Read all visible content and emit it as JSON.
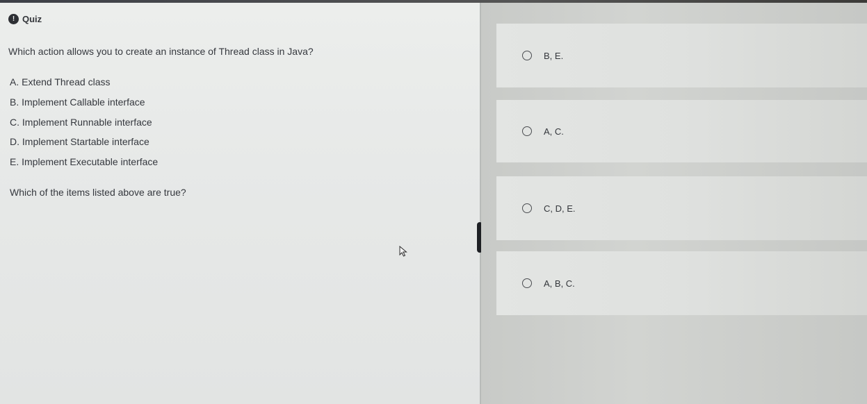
{
  "header": {
    "icon": "info-circle-icon",
    "icon_glyph": "!",
    "title": "Quiz"
  },
  "question": "Which action allows you to create an instance of Thread class in Java?",
  "options": [
    "A. Extend Thread class",
    "B. Implement Callable interface",
    "C. Implement Runnable interface",
    "D. Implement Startable interface",
    "E. Implement Executable interface"
  ],
  "prompt": "Which of the items listed above are true?",
  "answers": [
    "B, E.",
    "A, C.",
    "C, D, E.",
    "A, B, C."
  ]
}
